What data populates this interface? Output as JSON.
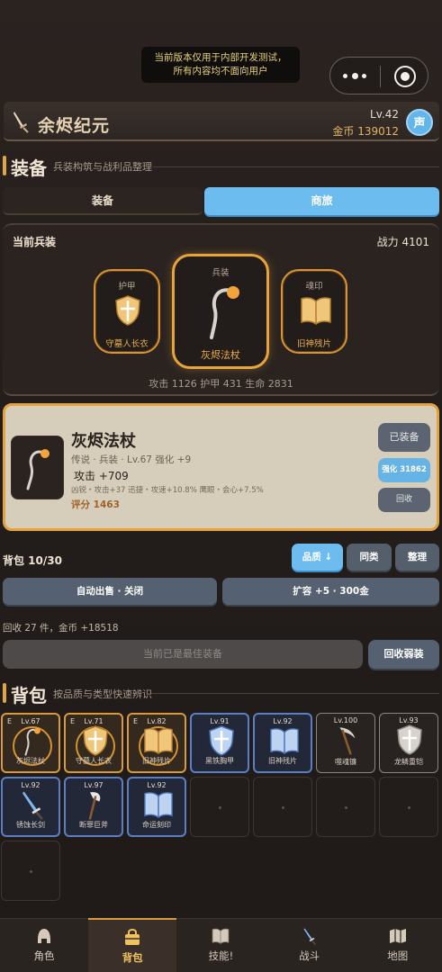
{
  "dev_notice": {
    "line1": "当前版本仅用于内部开发测试，",
    "line2": "所有内容均不面向用户"
  },
  "header": {
    "title": "余烬纪元",
    "level": "Lv.42",
    "gold": "金币 139012",
    "sound_label": "声"
  },
  "equip_section": {
    "title": "装备",
    "subtitle": "兵装构筑与战利品整理"
  },
  "tabs": [
    {
      "label": "装备"
    },
    {
      "label": "商旅"
    }
  ],
  "current": {
    "title": "当前兵装",
    "power": "战力 4101",
    "slots": [
      {
        "cap": "护甲",
        "name": "守墓人长衣",
        "icon": "shield-icon"
      },
      {
        "cap": "兵装",
        "name": "灰烬法杖",
        "icon": "staff-icon"
      },
      {
        "cap": "魂印",
        "name": "旧神残片",
        "icon": "book-icon"
      }
    ],
    "stats": "攻击 1126   护甲 431   生命 2831"
  },
  "detail": {
    "name": "灰烬法杖",
    "meta": "传说 · 兵装 · Lv.67   强化 +9",
    "attack": "攻击 +709",
    "affixes": "凶锐・攻击+37    迅捷・攻速+10.8%    鹰眼・会心+7.5%",
    "score": "评分 1463",
    "btn_equipped": "已装备",
    "btn_enhance": "强化 31862",
    "btn_recycle": "回收"
  },
  "bag_controls": {
    "count": "背包 10/30",
    "quality": "品质 ↓",
    "same": "同类",
    "sort": "整理",
    "auto_sell": "自动出售 · 关闭",
    "expand": "扩容 +5 · 300金",
    "recycle_info": "回收 27 件，金币 +18518",
    "best_msg": "当前已是最佳装备",
    "recycle_weak": "回收弱装"
  },
  "bag_section": {
    "title": "背包",
    "subtitle": "按品质与类型快速辨识"
  },
  "bag_items": [
    {
      "lv": "Lv.67",
      "name": "灰烬法杖",
      "icon": "staff-icon",
      "rarity": "leg",
      "flag": "E",
      "ring": true
    },
    {
      "lv": "Lv.71",
      "name": "守墓人长衣",
      "icon": "shield-icon",
      "rarity": "leg",
      "flag": "E",
      "ring": true
    },
    {
      "lv": "Lv.82",
      "name": "旧神残片",
      "icon": "book-icon",
      "rarity": "leg",
      "flag": "E",
      "ring": true
    },
    {
      "lv": "Lv.91",
      "name": "黑铁胸甲",
      "icon": "shield-icon",
      "rarity": "epic"
    },
    {
      "lv": "Lv.92",
      "name": "旧神残片",
      "icon": "book-icon",
      "rarity": "epic"
    },
    {
      "lv": "Lv.100",
      "name": "噬魂镰",
      "icon": "scythe-icon",
      "rarity": "rare"
    },
    {
      "lv": "Lv.93",
      "name": "龙鳞重铠",
      "icon": "shield-icon",
      "rarity": "rare"
    },
    {
      "lv": "Lv.92",
      "name": "锈蚀长剑",
      "icon": "sword-icon",
      "rarity": "epic"
    },
    {
      "lv": "Lv.97",
      "name": "断罪巨斧",
      "icon": "axe-icon",
      "rarity": "epic"
    },
    {
      "lv": "Lv.92",
      "name": "命运刻印",
      "icon": "book-icon",
      "rarity": "epic"
    }
  ],
  "nav": [
    {
      "label": "角色",
      "icon": "helmet-icon"
    },
    {
      "label": "背包",
      "icon": "bag-icon"
    },
    {
      "label": "技能!",
      "icon": "book-icon"
    },
    {
      "label": "战斗",
      "icon": "sword-icon"
    },
    {
      "label": "地图",
      "icon": "map-icon"
    }
  ]
}
